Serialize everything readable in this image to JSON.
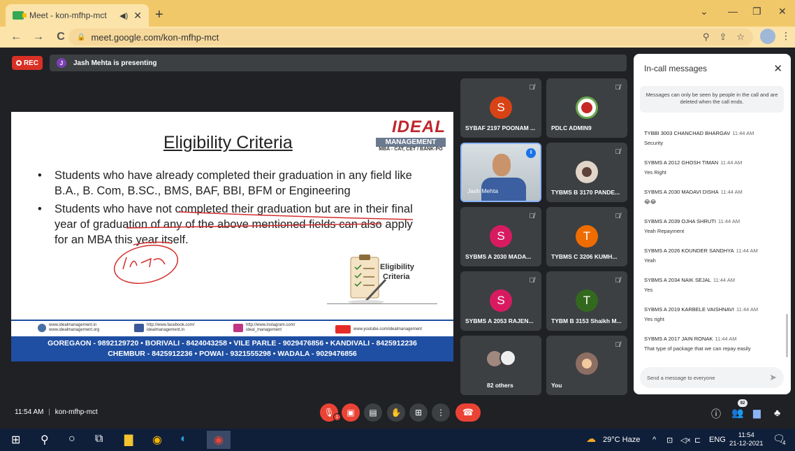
{
  "browser": {
    "tab_title": "Meet - kon-mfhp-mct",
    "url": "meet.google.com/kon-mfhp-mct",
    "win_min": "—",
    "win_max": "❐",
    "win_close": "✕",
    "new_tab": "+"
  },
  "header": {
    "rec_label": "REC",
    "presenter_initial": "J",
    "presenting_text": "Jash Mehta is presenting"
  },
  "slide": {
    "title": "Eligibility Criteria",
    "logo_main": "IDEAL",
    "logo_sub": "MANAGEMENT",
    "logo_tag": "MBA - CAT, CET / BANK-PO",
    "bullets": [
      "Students who have already completed their graduation in any field like B.A., B. Com, B.SC., BMS, BAF, BBI, BFM or Engineering",
      "Students who have not completed their graduation but are in their final year of graduation of any of the above mentioned fields can also apply for an MBA this year itself."
    ],
    "illus_label_1": "Eligibility",
    "illus_label_2": "Criteria",
    "social": {
      "web_1": "www.idealmanagement.in",
      "web_2": "www.idealmanagement.org",
      "fb_1": "http://www.facebook.com/",
      "fb_2": "idealmanagement.in",
      "ig_1": "http://www.instagram.com/",
      "ig_2": "ideal_management",
      "yt": "www.youtube.com/idealmanagement"
    },
    "branches_line1": "GOREGAON - 9892129720 • BORIVALI - 8424043258 • VILE PARLE - 9029476856 • KANDIVALI - 8425912236",
    "branches_line2": "CHEMBUR - 8425912236 • POWAI - 9321555298 • WADALA - 9029476856"
  },
  "tiles": [
    {
      "name": "SYBAF 2197 POONAM ...",
      "initial": "S",
      "color": "#d84315"
    },
    {
      "name": "PDLC ADMIN9",
      "initial": "",
      "color": "#6aa84f"
    },
    {
      "name": "Jash Mehta",
      "initial": "",
      "color": ""
    },
    {
      "name": "TYBMS B 3170 PANDE...",
      "initial": "",
      "color": "#5d4037"
    },
    {
      "name": "SYBMS A 2030 MADA...",
      "initial": "S",
      "color": "#d81b60"
    },
    {
      "name": "TYBMS C 3206 KUMH...",
      "initial": "T",
      "color": "#ef6c00"
    },
    {
      "name": "SYBMS A 2053 RAJEN...",
      "initial": "S",
      "color": "#d81b60"
    },
    {
      "name": "TYBM B 3153 Shaikh M...",
      "initial": "T",
      "color": "#33691e"
    },
    {
      "name": "82 others",
      "initial": "",
      "color": ""
    },
    {
      "name": "You",
      "initial": "",
      "color": "#8d6e63"
    }
  ],
  "chat": {
    "title": "In-call messages",
    "note": "Messages can only be seen by people in the call and are deleted when the call ends.",
    "messages": [
      {
        "sender": "TYBBI 3003 CHANCHAD BHARGAV",
        "time": "11:44 AM",
        "text": "Security"
      },
      {
        "sender": "SYBMS A 2012 GHOSH TIMAN",
        "time": "11:44 AM",
        "text": "Yes Right"
      },
      {
        "sender": "SYBMS A 2030 MADAVI DISHA",
        "time": "11:44 AM",
        "text": "😂😂"
      },
      {
        "sender": "SYBMS A 2039 OJHA SHRUTI",
        "time": "11:44 AM",
        "text": "Yeah Repayment"
      },
      {
        "sender": "SYBMS A 2026 KOUNDER SANDHYA",
        "time": "11:44 AM",
        "text": "Yeah"
      },
      {
        "sender": "SYBMS A 2034 NAIK SEJAL",
        "time": "11:44 AM",
        "text": "Yes"
      },
      {
        "sender": "SYBMS A 2019 KARBELE VAISHNAVI",
        "time": "11:44 AM",
        "text": "Yes right"
      },
      {
        "sender": "SYBMS A 2017 JAIN RONAK",
        "time": "11:44 AM",
        "text": "That type of package that we can repay easily"
      }
    ],
    "input_placeholder": "Send a message to everyone"
  },
  "bottom": {
    "time": "11:54 AM",
    "separator": "|",
    "meeting_code": "kon-mfhp-mct",
    "mic_badge": "1",
    "people_count": "92"
  },
  "taskbar": {
    "weather": "29°C  Haze",
    "lang": "ENG",
    "time": "11:54",
    "date": "21-12-2021",
    "notif_count": "4"
  }
}
